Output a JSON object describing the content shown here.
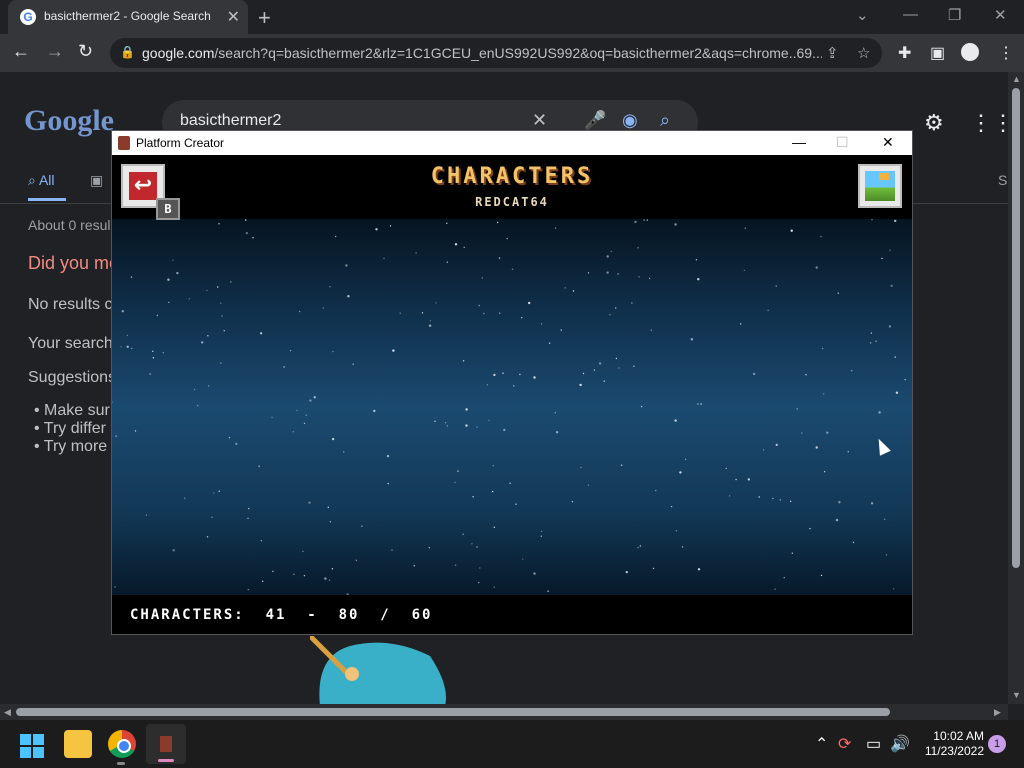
{
  "browser": {
    "tab_title": "basicthermer2 - Google Search",
    "tab_favicon": "G",
    "url_host": "google.com",
    "url_rest": "/search?q=basicthermer2&rlz=1C1GCEU_enUS992US992&oq=basicthermer2&aqs=chrome..69...",
    "new_tab": "+",
    "close": "✕"
  },
  "google": {
    "logo_text": "Google",
    "query": "basicthermer2",
    "tab_all": "All",
    "tab_s": "S",
    "results_count": "About 0 resul",
    "did_you_mean": "Did you me",
    "no_results": "No results c",
    "your_search": "Your search",
    "suggestions": "Suggestions",
    "bullets": [
      "Make sur",
      "Try differ",
      "Try more"
    ]
  },
  "app_window": {
    "title": "Platform Creator",
    "heading": "CHARACTERS",
    "subheading": "REDCAT64",
    "key_hint": "B",
    "footer": "CHARACTERS:  41  -  80  /  60"
  },
  "taskbar": {
    "time": "10:02 AM",
    "date": "11/23/2022",
    "notification_count": "1"
  }
}
